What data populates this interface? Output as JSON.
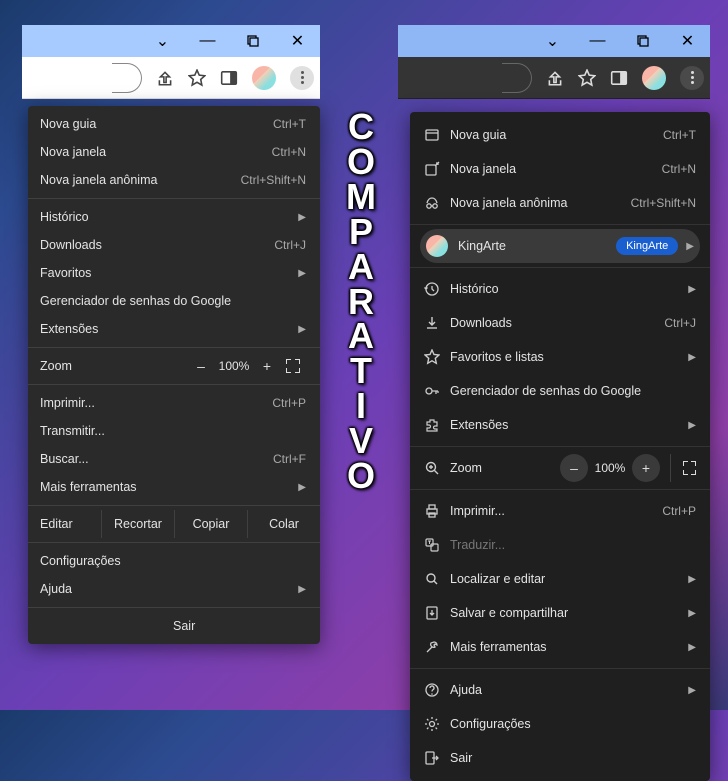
{
  "center_label": "COMPARATIVO",
  "titlebar": {
    "minimize": "–",
    "maximize": "❐",
    "close": "✕",
    "tabdrop": "⌄"
  },
  "toolbar": {
    "share": "share-icon",
    "star": "star-icon",
    "panel": "panel-icon",
    "kebab": "kebab"
  },
  "menuA": {
    "nova_guia": {
      "label": "Nova guia",
      "shortcut": "Ctrl+T"
    },
    "nova_janela": {
      "label": "Nova janela",
      "shortcut": "Ctrl+N"
    },
    "nova_anon": {
      "label": "Nova janela anônima",
      "shortcut": "Ctrl+Shift+N"
    },
    "historico": {
      "label": "Histórico"
    },
    "downloads": {
      "label": "Downloads",
      "shortcut": "Ctrl+J"
    },
    "favoritos": {
      "label": "Favoritos"
    },
    "senhas": {
      "label": "Gerenciador de senhas do Google"
    },
    "extensoes": {
      "label": "Extensões"
    },
    "zoom": {
      "label": "Zoom",
      "minus": "–",
      "value": "100%",
      "plus": "+"
    },
    "imprimir": {
      "label": "Imprimir...",
      "shortcut": "Ctrl+P"
    },
    "transmitir": {
      "label": "Transmitir..."
    },
    "buscar": {
      "label": "Buscar...",
      "shortcut": "Ctrl+F"
    },
    "mais": {
      "label": "Mais ferramentas"
    },
    "editar": {
      "label": "Editar",
      "cut": "Recortar",
      "copy": "Copiar",
      "paste": "Colar"
    },
    "config": {
      "label": "Configurações"
    },
    "ajuda": {
      "label": "Ajuda"
    },
    "sair": {
      "label": "Sair"
    }
  },
  "menuB": {
    "nova_guia": {
      "label": "Nova guia",
      "shortcut": "Ctrl+T"
    },
    "nova_janela": {
      "label": "Nova janela",
      "shortcut": "Ctrl+N"
    },
    "nova_anon": {
      "label": "Nova janela anônima",
      "shortcut": "Ctrl+Shift+N"
    },
    "profile": {
      "name": "KingArte",
      "badge": "KingArte"
    },
    "historico": {
      "label": "Histórico"
    },
    "downloads": {
      "label": "Downloads",
      "shortcut": "Ctrl+J"
    },
    "favoritos": {
      "label": "Favoritos e listas"
    },
    "senhas": {
      "label": "Gerenciador de senhas do Google"
    },
    "extensoes": {
      "label": "Extensões"
    },
    "zoom": {
      "label": "Zoom",
      "minus": "–",
      "value": "100%",
      "plus": "+"
    },
    "imprimir": {
      "label": "Imprimir...",
      "shortcut": "Ctrl+P"
    },
    "traduzir": {
      "label": "Traduzir..."
    },
    "localizar": {
      "label": "Localizar e editar"
    },
    "salvar": {
      "label": "Salvar e compartilhar"
    },
    "mais": {
      "label": "Mais ferramentas"
    },
    "ajuda": {
      "label": "Ajuda"
    },
    "config": {
      "label": "Configurações"
    },
    "sair": {
      "label": "Sair"
    }
  }
}
